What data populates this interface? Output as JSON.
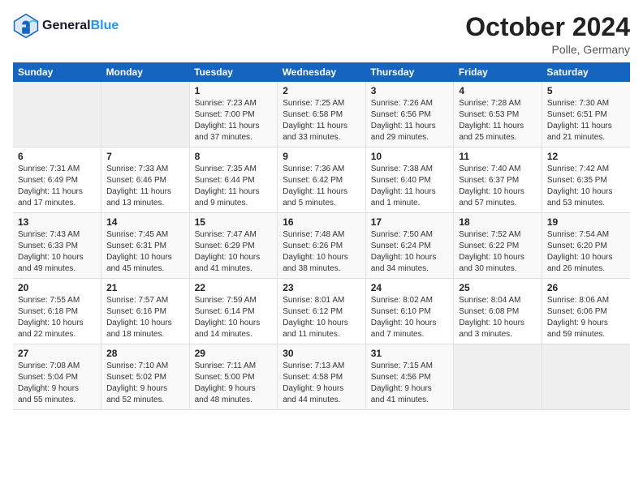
{
  "logo": {
    "line1": "General",
    "line2": "Blue"
  },
  "title": "October 2024",
  "location": "Polle, Germany",
  "weekdays": [
    "Sunday",
    "Monday",
    "Tuesday",
    "Wednesday",
    "Thursday",
    "Friday",
    "Saturday"
  ],
  "rows": [
    [
      {
        "day": "",
        "content": ""
      },
      {
        "day": "",
        "content": ""
      },
      {
        "day": "1",
        "content": "Sunrise: 7:23 AM\nSunset: 7:00 PM\nDaylight: 11 hours\nand 37 minutes."
      },
      {
        "day": "2",
        "content": "Sunrise: 7:25 AM\nSunset: 6:58 PM\nDaylight: 11 hours\nand 33 minutes."
      },
      {
        "day": "3",
        "content": "Sunrise: 7:26 AM\nSunset: 6:56 PM\nDaylight: 11 hours\nand 29 minutes."
      },
      {
        "day": "4",
        "content": "Sunrise: 7:28 AM\nSunset: 6:53 PM\nDaylight: 11 hours\nand 25 minutes."
      },
      {
        "day": "5",
        "content": "Sunrise: 7:30 AM\nSunset: 6:51 PM\nDaylight: 11 hours\nand 21 minutes."
      }
    ],
    [
      {
        "day": "6",
        "content": "Sunrise: 7:31 AM\nSunset: 6:49 PM\nDaylight: 11 hours\nand 17 minutes."
      },
      {
        "day": "7",
        "content": "Sunrise: 7:33 AM\nSunset: 6:46 PM\nDaylight: 11 hours\nand 13 minutes."
      },
      {
        "day": "8",
        "content": "Sunrise: 7:35 AM\nSunset: 6:44 PM\nDaylight: 11 hours\nand 9 minutes."
      },
      {
        "day": "9",
        "content": "Sunrise: 7:36 AM\nSunset: 6:42 PM\nDaylight: 11 hours\nand 5 minutes."
      },
      {
        "day": "10",
        "content": "Sunrise: 7:38 AM\nSunset: 6:40 PM\nDaylight: 11 hours\nand 1 minute."
      },
      {
        "day": "11",
        "content": "Sunrise: 7:40 AM\nSunset: 6:37 PM\nDaylight: 10 hours\nand 57 minutes."
      },
      {
        "day": "12",
        "content": "Sunrise: 7:42 AM\nSunset: 6:35 PM\nDaylight: 10 hours\nand 53 minutes."
      }
    ],
    [
      {
        "day": "13",
        "content": "Sunrise: 7:43 AM\nSunset: 6:33 PM\nDaylight: 10 hours\nand 49 minutes."
      },
      {
        "day": "14",
        "content": "Sunrise: 7:45 AM\nSunset: 6:31 PM\nDaylight: 10 hours\nand 45 minutes."
      },
      {
        "day": "15",
        "content": "Sunrise: 7:47 AM\nSunset: 6:29 PM\nDaylight: 10 hours\nand 41 minutes."
      },
      {
        "day": "16",
        "content": "Sunrise: 7:48 AM\nSunset: 6:26 PM\nDaylight: 10 hours\nand 38 minutes."
      },
      {
        "day": "17",
        "content": "Sunrise: 7:50 AM\nSunset: 6:24 PM\nDaylight: 10 hours\nand 34 minutes."
      },
      {
        "day": "18",
        "content": "Sunrise: 7:52 AM\nSunset: 6:22 PM\nDaylight: 10 hours\nand 30 minutes."
      },
      {
        "day": "19",
        "content": "Sunrise: 7:54 AM\nSunset: 6:20 PM\nDaylight: 10 hours\nand 26 minutes."
      }
    ],
    [
      {
        "day": "20",
        "content": "Sunrise: 7:55 AM\nSunset: 6:18 PM\nDaylight: 10 hours\nand 22 minutes."
      },
      {
        "day": "21",
        "content": "Sunrise: 7:57 AM\nSunset: 6:16 PM\nDaylight: 10 hours\nand 18 minutes."
      },
      {
        "day": "22",
        "content": "Sunrise: 7:59 AM\nSunset: 6:14 PM\nDaylight: 10 hours\nand 14 minutes."
      },
      {
        "day": "23",
        "content": "Sunrise: 8:01 AM\nSunset: 6:12 PM\nDaylight: 10 hours\nand 11 minutes."
      },
      {
        "day": "24",
        "content": "Sunrise: 8:02 AM\nSunset: 6:10 PM\nDaylight: 10 hours\nand 7 minutes."
      },
      {
        "day": "25",
        "content": "Sunrise: 8:04 AM\nSunset: 6:08 PM\nDaylight: 10 hours\nand 3 minutes."
      },
      {
        "day": "26",
        "content": "Sunrise: 8:06 AM\nSunset: 6:06 PM\nDaylight: 9 hours\nand 59 minutes."
      }
    ],
    [
      {
        "day": "27",
        "content": "Sunrise: 7:08 AM\nSunset: 5:04 PM\nDaylight: 9 hours\nand 55 minutes."
      },
      {
        "day": "28",
        "content": "Sunrise: 7:10 AM\nSunset: 5:02 PM\nDaylight: 9 hours\nand 52 minutes."
      },
      {
        "day": "29",
        "content": "Sunrise: 7:11 AM\nSunset: 5:00 PM\nDaylight: 9 hours\nand 48 minutes."
      },
      {
        "day": "30",
        "content": "Sunrise: 7:13 AM\nSunset: 4:58 PM\nDaylight: 9 hours\nand 44 minutes."
      },
      {
        "day": "31",
        "content": "Sunrise: 7:15 AM\nSunset: 4:56 PM\nDaylight: 9 hours\nand 41 minutes."
      },
      {
        "day": "",
        "content": ""
      },
      {
        "day": "",
        "content": ""
      }
    ]
  ]
}
